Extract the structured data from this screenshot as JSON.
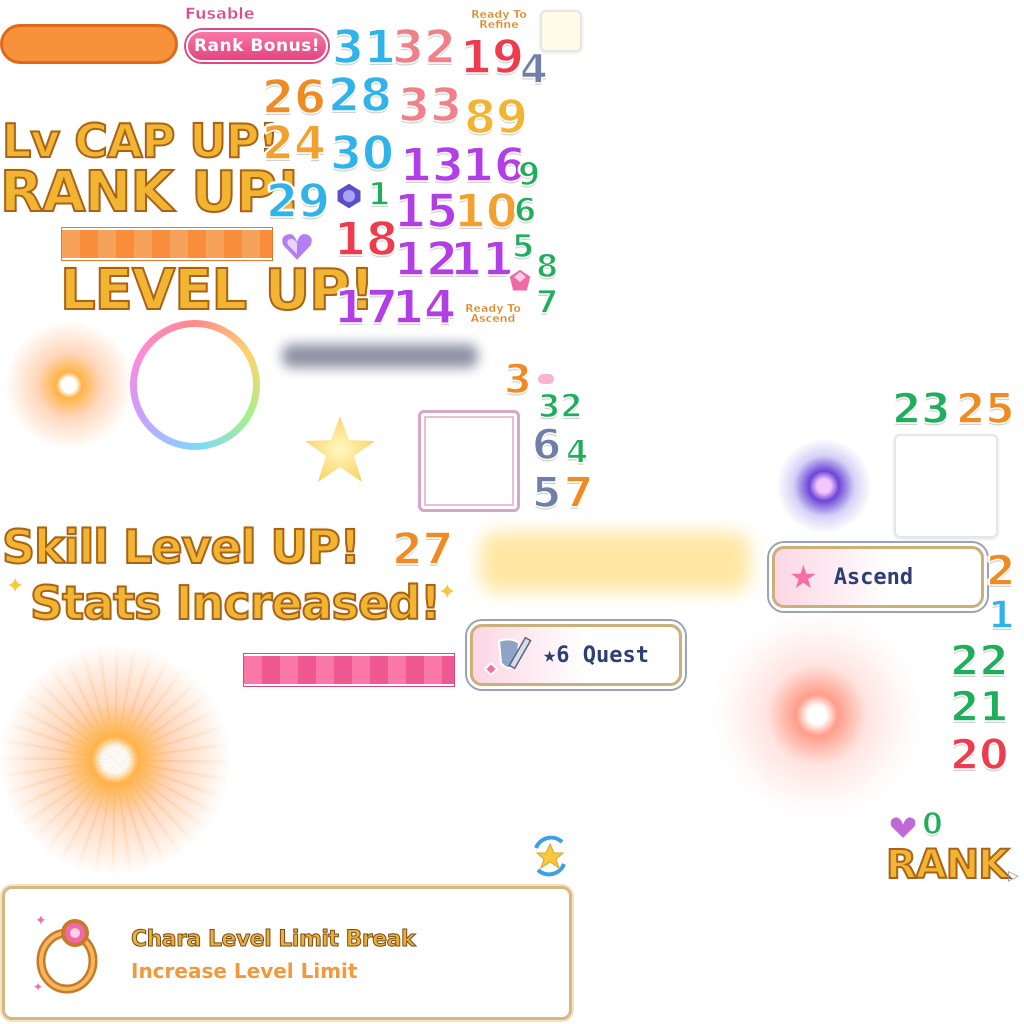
{
  "labels": {
    "fusable": "Fusable",
    "rank_bonus": "Rank Bonus!",
    "ready_to_refine": "Ready To Refine",
    "ready_to_ascend": "Ready To Ascend",
    "lv_cap_up": "Lv CAP UP!",
    "rank_up": "RANK UP!",
    "level_up": "LEVEL UP!",
    "skill_level_up": "Skill Level UP!",
    "stats_increased": "Stats Increased!",
    "ascend": "Ascend",
    "quest": "★6 Quest",
    "rank": "RANK"
  },
  "numbers": {
    "n31": "31",
    "n32a": "32",
    "n19": "19",
    "n4a": "4",
    "n26": "26",
    "n28": "28",
    "n33": "33",
    "n89": "89",
    "n24": "24",
    "n30": "30",
    "n13": "13",
    "n16": "16",
    "n9": "9",
    "n29": "29",
    "n1a": "1",
    "n15": "15",
    "n10": "10",
    "n6a": "6",
    "n18": "18",
    "n12": "12",
    "n11": "11",
    "n5a": "5",
    "n8": "8",
    "n17": "17",
    "n14": "14",
    "n7a": "7",
    "n3": "3",
    "n32b": "32",
    "n6b": "6",
    "n4b": "4",
    "n5b": "5",
    "n7b": "7",
    "n27": "27",
    "n23": "23",
    "n25": "25",
    "n2": "2",
    "n1b": "1",
    "n22": "22",
    "n21": "21",
    "n20": "20",
    "n0": "0"
  },
  "panel": {
    "title": "Chara Level Limit Break",
    "subtitle": "Increase Level Limit"
  },
  "colors": {
    "blue": "#2fb3e8",
    "pink": "#f06a7a",
    "orange": "#f08a22",
    "gold": "#f2b532",
    "purple": "#b23ee6",
    "green": "#1fae5c",
    "red": "#ee3b4e",
    "slate": "#6f7faa"
  },
  "icons": [
    "sparkle-icon",
    "crystal-heart-icon",
    "star-icon",
    "sword-shield-icon",
    "gold-ring-icon",
    "refresh-star-icon",
    "arrow-right-icon"
  ]
}
